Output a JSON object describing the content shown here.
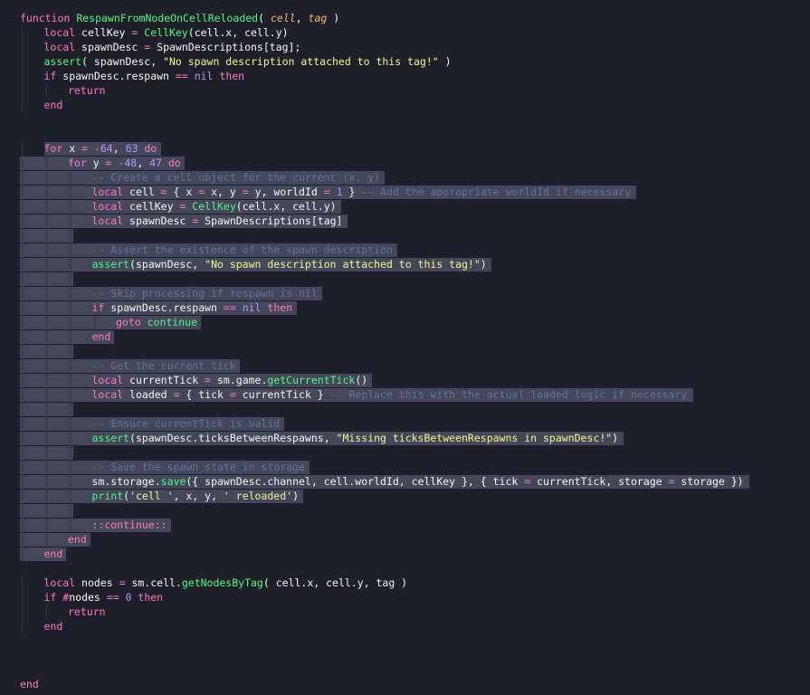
{
  "editor": {
    "lines": [
      {
        "indent": 0,
        "sel": null,
        "tokens": [
          [
            "kw",
            "function "
          ],
          [
            "fn",
            "RespawnFromNodeOnCellReloaded"
          ],
          [
            "punc",
            "( "
          ],
          [
            "param",
            "cell"
          ],
          [
            "punc",
            ", "
          ],
          [
            "param",
            "tag"
          ],
          [
            "punc",
            " )"
          ]
        ]
      },
      {
        "indent": 1,
        "sel": null,
        "tokens": [
          [
            "kw",
            "local "
          ],
          [
            "var",
            "cellKey "
          ],
          [
            "op",
            "= "
          ],
          [
            "fn",
            "CellKey"
          ],
          [
            "punc",
            "(cell.x, cell.y)"
          ]
        ]
      },
      {
        "indent": 1,
        "sel": null,
        "tokens": [
          [
            "kw",
            "local "
          ],
          [
            "var",
            "spawnDesc "
          ],
          [
            "op",
            "= "
          ],
          [
            "var",
            "SpawnDescriptions[tag];"
          ]
        ]
      },
      {
        "indent": 1,
        "sel": null,
        "tokens": [
          [
            "fn",
            "assert"
          ],
          [
            "punc",
            "( spawnDesc, "
          ],
          [
            "str",
            "\"No spawn description attached to this tag!\""
          ],
          [
            "punc",
            " )"
          ]
        ]
      },
      {
        "indent": 1,
        "sel": null,
        "tokens": [
          [
            "kw",
            "if "
          ],
          [
            "var",
            "spawnDesc.respawn "
          ],
          [
            "op",
            "== "
          ],
          [
            "num",
            "nil "
          ],
          [
            "kw",
            "then"
          ]
        ]
      },
      {
        "indent": 2,
        "sel": null,
        "tokens": [
          [
            "kw",
            "return"
          ]
        ]
      },
      {
        "indent": 1,
        "sel": null,
        "tokens": [
          [
            "kw",
            "end"
          ]
        ]
      },
      {
        "indent": 0,
        "sel": null,
        "tokens": []
      },
      {
        "indent": 0,
        "sel": null,
        "tokens": []
      },
      {
        "indent": 1,
        "sel": "text",
        "tokens": [
          [
            "kw",
            "for "
          ],
          [
            "var",
            "x "
          ],
          [
            "op",
            "= "
          ],
          [
            "num",
            "-64"
          ],
          [
            "punc",
            ", "
          ],
          [
            "num",
            "63 "
          ],
          [
            "kw",
            "do"
          ]
        ]
      },
      {
        "indent": 2,
        "sel": "full",
        "tokens": [
          [
            "kw",
            "for "
          ],
          [
            "var",
            "y "
          ],
          [
            "op",
            "= "
          ],
          [
            "num",
            "-48"
          ],
          [
            "punc",
            ", "
          ],
          [
            "num",
            "47 "
          ],
          [
            "kw",
            "do"
          ]
        ]
      },
      {
        "indent": 3,
        "sel": "full",
        "tokens": [
          [
            "cm",
            "-- Create a cell object for the current (x, y)"
          ]
        ]
      },
      {
        "indent": 3,
        "sel": "full",
        "tokens": [
          [
            "kw",
            "local "
          ],
          [
            "var",
            "cell "
          ],
          [
            "op",
            "= "
          ],
          [
            "punc",
            "{ x "
          ],
          [
            "op",
            "= "
          ],
          [
            "punc",
            "x, y "
          ],
          [
            "op",
            "= "
          ],
          [
            "punc",
            "y, worldId "
          ],
          [
            "op",
            "= "
          ],
          [
            "num",
            "1 "
          ],
          [
            "punc",
            "} "
          ],
          [
            "cm",
            "-- Add the appropriate worldId if necessary"
          ]
        ]
      },
      {
        "indent": 3,
        "sel": "full",
        "tokens": [
          [
            "kw",
            "local "
          ],
          [
            "var",
            "cellKey "
          ],
          [
            "op",
            "= "
          ],
          [
            "fn",
            "CellKey"
          ],
          [
            "punc",
            "(cell.x, cell.y)"
          ]
        ]
      },
      {
        "indent": 3,
        "sel": "full",
        "tokens": [
          [
            "kw",
            "local "
          ],
          [
            "var",
            "spawnDesc "
          ],
          [
            "op",
            "= "
          ],
          [
            "var",
            "SpawnDescriptions[tag]"
          ]
        ]
      },
      {
        "indent": 0,
        "sel": "empty",
        "tokens": []
      },
      {
        "indent": 3,
        "sel": "full",
        "tokens": [
          [
            "cm",
            "-- Assert the existence of the spawn description"
          ]
        ]
      },
      {
        "indent": 3,
        "sel": "full",
        "tokens": [
          [
            "fn",
            "assert"
          ],
          [
            "punc",
            "(spawnDesc, "
          ],
          [
            "str",
            "\"No spawn description attached to this tag!\""
          ],
          [
            "punc",
            ")"
          ]
        ]
      },
      {
        "indent": 0,
        "sel": "empty",
        "tokens": []
      },
      {
        "indent": 3,
        "sel": "full",
        "tokens": [
          [
            "cm",
            "-- Skip processing if respawn is nil"
          ]
        ]
      },
      {
        "indent": 3,
        "sel": "full",
        "tokens": [
          [
            "kw",
            "if "
          ],
          [
            "var",
            "spawnDesc.respawn "
          ],
          [
            "op",
            "== "
          ],
          [
            "num",
            "nil "
          ],
          [
            "kw",
            "then"
          ]
        ]
      },
      {
        "indent": 4,
        "sel": "full",
        "tokens": [
          [
            "kw",
            "goto "
          ],
          [
            "fn",
            "continue"
          ]
        ]
      },
      {
        "indent": 3,
        "sel": "full",
        "tokens": [
          [
            "kw",
            "end"
          ]
        ]
      },
      {
        "indent": 0,
        "sel": "empty",
        "tokens": []
      },
      {
        "indent": 3,
        "sel": "full",
        "tokens": [
          [
            "cm",
            "-- Get the current tick"
          ]
        ]
      },
      {
        "indent": 3,
        "sel": "full",
        "tokens": [
          [
            "kw",
            "local "
          ],
          [
            "var",
            "currentTick "
          ],
          [
            "op",
            "= "
          ],
          [
            "var",
            "sm.game."
          ],
          [
            "fn",
            "getCurrentTick"
          ],
          [
            "punc",
            "()"
          ]
        ]
      },
      {
        "indent": 3,
        "sel": "full",
        "tokens": [
          [
            "kw",
            "local "
          ],
          [
            "var",
            "loaded "
          ],
          [
            "op",
            "= "
          ],
          [
            "punc",
            "{ tick "
          ],
          [
            "op",
            "= "
          ],
          [
            "punc",
            "currentTick } "
          ],
          [
            "cm",
            "-- Replace this with the actual loaded logic if necessary"
          ]
        ]
      },
      {
        "indent": 0,
        "sel": "empty",
        "tokens": []
      },
      {
        "indent": 3,
        "sel": "full",
        "tokens": [
          [
            "cm",
            "-- Ensure currentTick is valid"
          ]
        ]
      },
      {
        "indent": 3,
        "sel": "full",
        "tokens": [
          [
            "fn",
            "assert"
          ],
          [
            "punc",
            "(spawnDesc.ticksBetweenRespawns, "
          ],
          [
            "str",
            "\"Missing ticksBetweenRespawns in spawnDesc!\""
          ],
          [
            "punc",
            ")"
          ]
        ]
      },
      {
        "indent": 0,
        "sel": "empty",
        "tokens": []
      },
      {
        "indent": 3,
        "sel": "full",
        "tokens": [
          [
            "cm",
            "-- Save the spawn state in storage"
          ]
        ]
      },
      {
        "indent": 3,
        "sel": "full",
        "tokens": [
          [
            "var",
            "sm.storage."
          ],
          [
            "fn",
            "save"
          ],
          [
            "punc",
            "({ spawnDesc.channel, cell.worldId, cellKey }, { tick "
          ],
          [
            "op",
            "= "
          ],
          [
            "punc",
            "currentTick, storage "
          ],
          [
            "op",
            "= "
          ],
          [
            "punc",
            "storage })"
          ]
        ]
      },
      {
        "indent": 3,
        "sel": "full",
        "tokens": [
          [
            "fn",
            "print"
          ],
          [
            "punc",
            "("
          ],
          [
            "str",
            "'cell '"
          ],
          [
            "punc",
            ", x, y, "
          ],
          [
            "str",
            "' reloaded'"
          ],
          [
            "punc",
            ")"
          ]
        ]
      },
      {
        "indent": 0,
        "sel": "empty",
        "tokens": []
      },
      {
        "indent": 3,
        "sel": "full",
        "tokens": [
          [
            "kw",
            "::continue::"
          ]
        ]
      },
      {
        "indent": 2,
        "sel": "full",
        "tokens": [
          [
            "kw",
            "end"
          ]
        ]
      },
      {
        "indent": 1,
        "sel": "full",
        "tokens": [
          [
            "kw",
            "end"
          ]
        ]
      },
      {
        "indent": 0,
        "sel": null,
        "tokens": []
      },
      {
        "indent": 1,
        "sel": null,
        "tokens": [
          [
            "kw",
            "local "
          ],
          [
            "var",
            "nodes "
          ],
          [
            "op",
            "= "
          ],
          [
            "var",
            "sm.cell."
          ],
          [
            "fn",
            "getNodesByTag"
          ],
          [
            "punc",
            "( cell.x, cell.y, tag )"
          ]
        ]
      },
      {
        "indent": 1,
        "sel": null,
        "tokens": [
          [
            "kw",
            "if "
          ],
          [
            "op",
            "#"
          ],
          [
            "var",
            "nodes "
          ],
          [
            "op",
            "== "
          ],
          [
            "num",
            "0 "
          ],
          [
            "kw",
            "then"
          ]
        ]
      },
      {
        "indent": 2,
        "sel": null,
        "tokens": [
          [
            "kw",
            "return"
          ]
        ]
      },
      {
        "indent": 1,
        "sel": null,
        "tokens": [
          [
            "kw",
            "end"
          ]
        ]
      },
      {
        "indent": 0,
        "sel": null,
        "tokens": []
      },
      {
        "indent": 0,
        "sel": null,
        "tokens": []
      },
      {
        "indent": 0,
        "sel": null,
        "tokens": []
      },
      {
        "indent": 0,
        "sel": null,
        "tokens": [
          [
            "kw",
            "end"
          ]
        ]
      }
    ]
  }
}
